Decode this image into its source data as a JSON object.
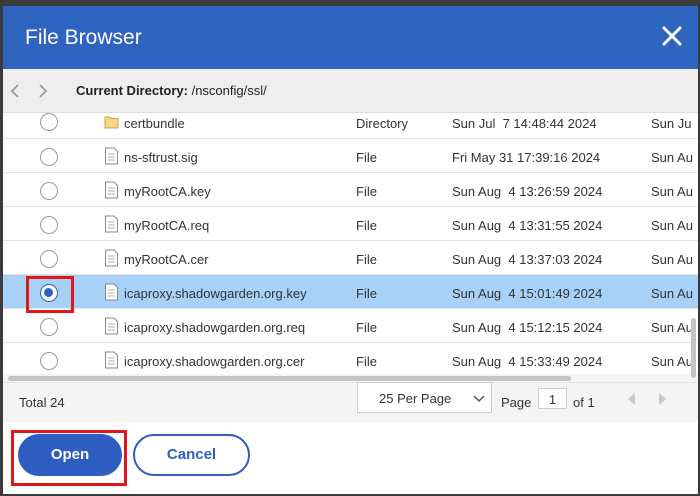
{
  "dialog": {
    "title": "File Browser"
  },
  "pathbar": {
    "current_dir_label": "Current Directory:",
    "current_dir_value": " /nsconfig/ssl/"
  },
  "files": [
    {
      "name": "certbundle",
      "type": "Directory",
      "date": "Sun Jul  7 14:48:44 2024",
      "modified": "Sun Ju",
      "icon": "folder-icon",
      "selected": false
    },
    {
      "name": "ns-sftrust.sig",
      "type": "File",
      "date": "Fri May 31 17:39:16 2024",
      "modified": "Sun Au",
      "icon": "file-icon",
      "selected": false
    },
    {
      "name": "myRootCA.key",
      "type": "File",
      "date": "Sun Aug  4 13:26:59 2024",
      "modified": "Sun Au",
      "icon": "file-icon",
      "selected": false
    },
    {
      "name": "myRootCA.req",
      "type": "File",
      "date": "Sun Aug  4 13:31:55 2024",
      "modified": "Sun Au",
      "icon": "file-icon",
      "selected": false
    },
    {
      "name": "myRootCA.cer",
      "type": "File",
      "date": "Sun Aug  4 13:37:03 2024",
      "modified": "Sun Au",
      "icon": "file-icon",
      "selected": false
    },
    {
      "name": "icaproxy.shadowgarden.org.key",
      "type": "File",
      "date": "Sun Aug  4 15:01:49 2024",
      "modified": "Sun Au",
      "icon": "file-icon",
      "selected": true
    },
    {
      "name": "icaproxy.shadowgarden.org.req",
      "type": "File",
      "date": "Sun Aug  4 15:12:15 2024",
      "modified": "Sun Au",
      "icon": "file-icon",
      "selected": false
    },
    {
      "name": "icaproxy.shadowgarden.org.cer",
      "type": "File",
      "date": "Sun Aug  4 15:33:49 2024",
      "modified": "Sun Au",
      "icon": "file-icon",
      "selected": false
    }
  ],
  "footer": {
    "total_label": "Total",
    "total_count": "24",
    "per_page": "25 Per Page",
    "page_label": "Page",
    "page_value": "1",
    "of_label": "of 1"
  },
  "actions": {
    "open_label": "Open",
    "cancel_label": "Cancel"
  },
  "colors": {
    "accent": "#2f63c0",
    "selected_row": "#a7d1f7",
    "highlight": "#e0161b"
  }
}
